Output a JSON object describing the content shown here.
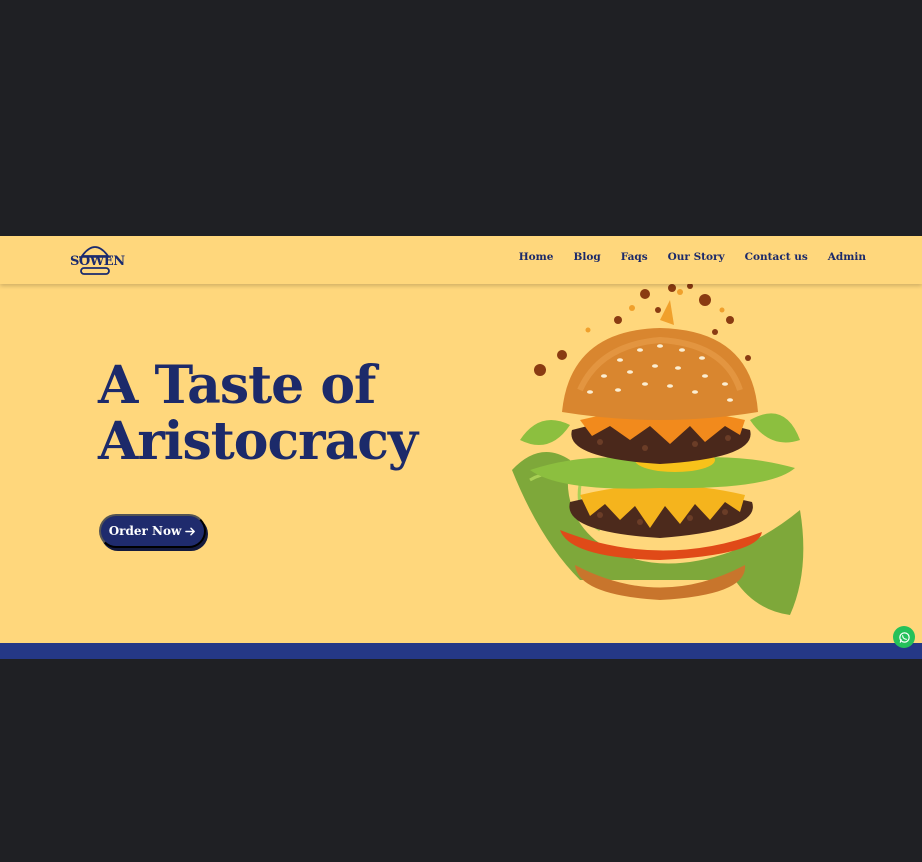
{
  "brand": {
    "logo_text": "SOWEN"
  },
  "nav": {
    "items": [
      {
        "label": "Home"
      },
      {
        "label": "Blog"
      },
      {
        "label": "Faqs"
      },
      {
        "label": "Our Story"
      },
      {
        "label": "Contact us"
      },
      {
        "label": "Admin"
      }
    ]
  },
  "hero": {
    "title_line1": "A Taste of",
    "title_line2": "Aristocracy",
    "cta_label": "Order Now"
  },
  "colors": {
    "background": "#ffd77c",
    "primary": "#1c2a6a",
    "footer_strip": "#253886",
    "whatsapp": "#25c15a",
    "outer": "#1f2024"
  },
  "icons": {
    "logo": "burger-logo-icon",
    "cta": "arrow-right-icon",
    "chat": "whatsapp-icon",
    "hero_image": "burger-image"
  }
}
